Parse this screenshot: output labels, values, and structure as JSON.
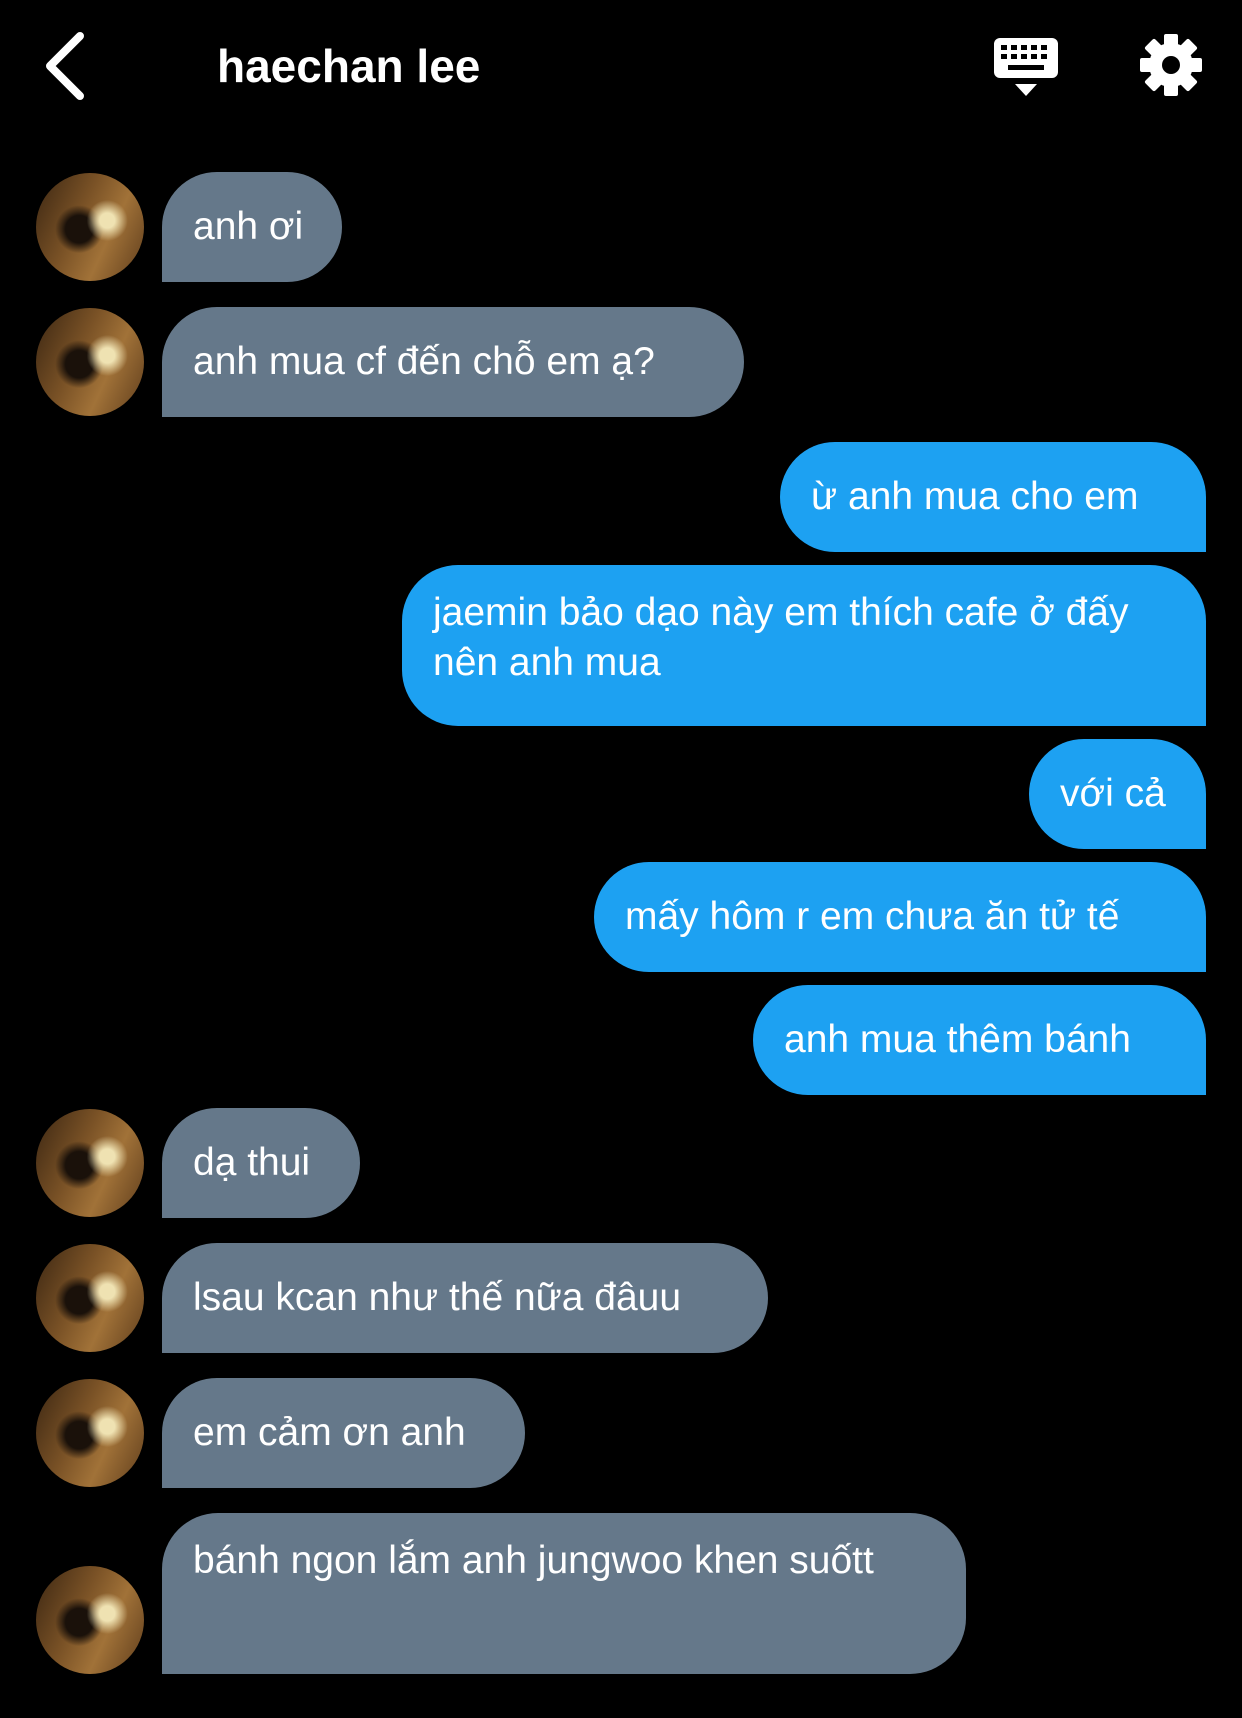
{
  "header": {
    "title": "haechan lee",
    "back_icon": "chevron-left-icon",
    "keyboard_icon": "keyboard-icon",
    "settings_icon": "gear-icon"
  },
  "colors": {
    "background": "#000000",
    "incoming_bubble": "#65788a",
    "outgoing_bubble": "#1da1f2",
    "text": "#ffffff"
  },
  "messages": [
    {
      "direction": "incoming",
      "text": "anh ơi"
    },
    {
      "direction": "incoming",
      "text": "anh mua cf đến chỗ em ạ?"
    },
    {
      "direction": "outgoing",
      "text": "ừ anh mua cho em"
    },
    {
      "direction": "outgoing",
      "text": "jaemin bảo dạo này em thích cafe ở đấy nên anh mua"
    },
    {
      "direction": "outgoing",
      "text": "với cả"
    },
    {
      "direction": "outgoing",
      "text": "mấy hôm r em chưa ăn tử tế"
    },
    {
      "direction": "outgoing",
      "text": "anh mua thêm bánh"
    },
    {
      "direction": "incoming",
      "text": "dạ thui"
    },
    {
      "direction": "incoming",
      "text": "lsau kcan như thế nữa đâuu"
    },
    {
      "direction": "incoming",
      "text": "em cảm ơn anh"
    },
    {
      "direction": "incoming",
      "text": "bánh ngon lắm anh jungwoo khen suốtt"
    }
  ]
}
